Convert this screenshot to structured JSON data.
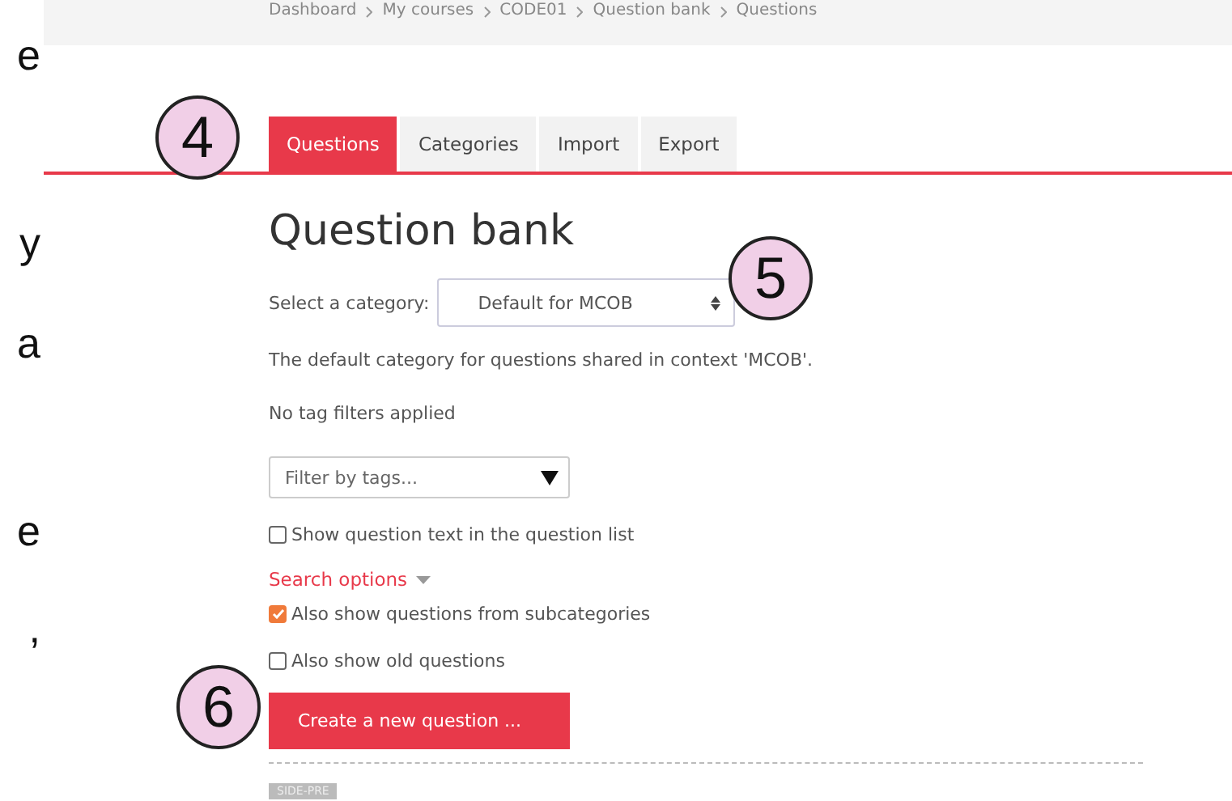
{
  "margin_fragments": [
    "e",
    "y",
    "a",
    "e",
    ","
  ],
  "breadcrumb": [
    "Dashboard",
    "My courses",
    "CODE01",
    "Question bank",
    "Questions"
  ],
  "tabs": [
    {
      "label": "Questions",
      "selected": true
    },
    {
      "label": "Categories",
      "selected": false
    },
    {
      "label": "Import",
      "selected": false
    },
    {
      "label": "Export",
      "selected": false
    }
  ],
  "heading": "Question bank",
  "category": {
    "label": "Select a category:",
    "value": "Default for MCOB",
    "description": "The default category for questions shared in context 'MCOB'."
  },
  "tag_status": "No tag filters applied",
  "tag_filter": {
    "placeholder": "Filter by tags..."
  },
  "show_text_option": {
    "label": "Show question text in the question list",
    "checked": false
  },
  "search_options": {
    "label": "Search options"
  },
  "search_checks": [
    {
      "label": "Also show questions from subcategories",
      "checked": true
    },
    {
      "label": "Also show old questions",
      "checked": false
    }
  ],
  "create_button": "Create a new question ...",
  "block_region": "SIDE-PRE",
  "callouts": [
    "4",
    "5",
    "6"
  ]
}
